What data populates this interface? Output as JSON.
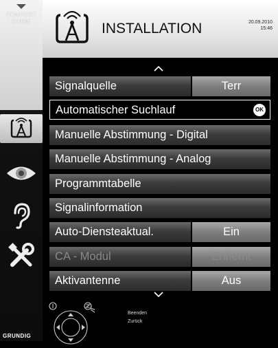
{
  "sidebar": {
    "comfort_guide_line1": "COMFORT",
    "comfort_guide_line2": "GUIDE",
    "brand": "GRUNDIG"
  },
  "header": {
    "title": "INSTALLATION",
    "date": "20.09.2010",
    "time": "15:46"
  },
  "menu": {
    "items": [
      {
        "label": "Signalquelle",
        "value": "Terr"
      },
      {
        "label": "Automatischer Suchlauf",
        "badge": "OK"
      },
      {
        "label": "Manuelle Abstimmung - Digital"
      },
      {
        "label": "Manuelle Abstimmung - Analog"
      },
      {
        "label": "Programmtabelle"
      },
      {
        "label": "Signalinformation"
      },
      {
        "label": "Auto-Diensteaktual.",
        "value": "Ein"
      },
      {
        "label": "CA - Modul",
        "value": "Entfernt"
      },
      {
        "label": "Aktivantenne",
        "value": "Aus"
      }
    ]
  },
  "footer": {
    "exit_label": "Beenden",
    "back_label": "Zurück"
  },
  "colors": {
    "row_label": "#3c3c3c",
    "row_value": "#7e7e7e",
    "disabled_text": "#8a8a8a"
  },
  "icons": [
    "antenna-icon",
    "eye-icon",
    "ear-icon",
    "tools-icon",
    "chevron-up-icon",
    "chevron-down-icon",
    "navigation-cross-icon"
  ]
}
